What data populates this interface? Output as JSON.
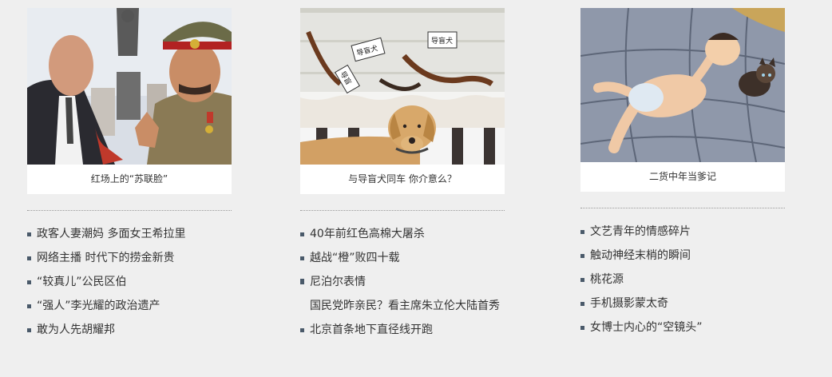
{
  "columns": [
    {
      "caption": "红场上的“苏联脸”",
      "image_desc": "photo-two-men-red-square",
      "links": [
        "政客人妻潮妈 多面女王希拉里",
        "网络主播 时代下的捞金新贵",
        "“较真儿”公民区伯",
        "“强人”李光耀的政治遗产",
        "敢为人先胡耀邦"
      ]
    },
    {
      "caption": "与导盲犬同车 你介意么？",
      "image_desc": "photo-guide-dog-harnesses",
      "tags": [
        "导盲犬",
        "导盲犬",
        "导盲"
      ],
      "links": [
        "40年前红色高棉大屠杀",
        "越战“橙”败四十载",
        "尼泊尔表情",
        "国民党昨亲民？看主席朱立伦大陆首秀",
        "北京首条地下直径线开跑"
      ]
    },
    {
      "caption": "二货中年当爹记",
      "image_desc": "photo-baby-and-cat-on-bed",
      "links": [
        "文艺青年的情感碎片",
        "触动神经末梢的瞬间",
        "桃花源",
        "手机摄影蒙太奇",
        "女博士内心的“空镜头”"
      ]
    }
  ]
}
